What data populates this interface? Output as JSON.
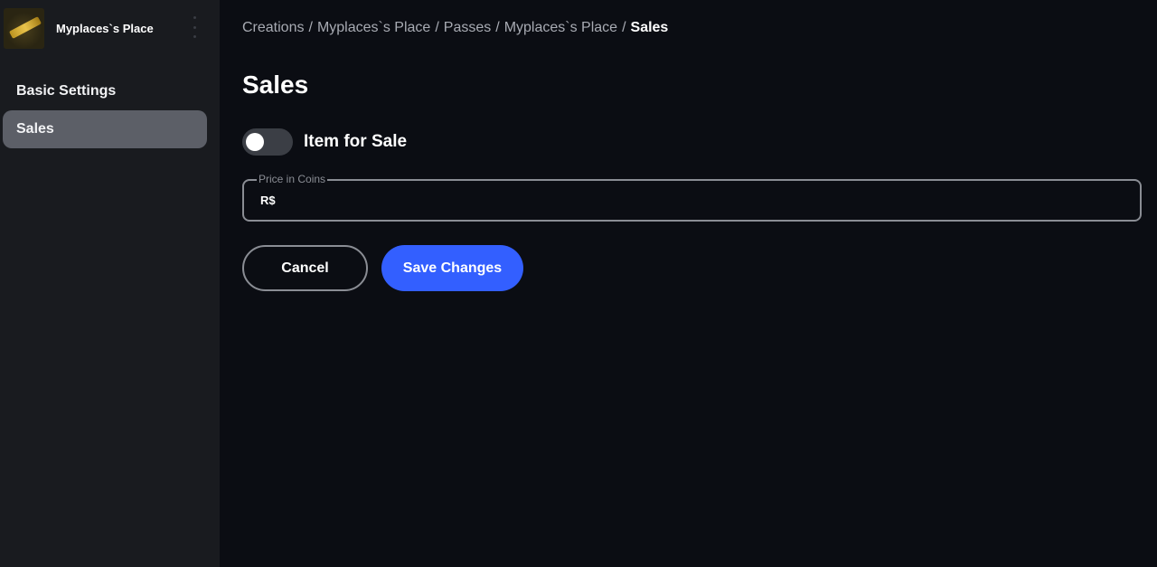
{
  "sidebar": {
    "place_name": "Myplaces`s Place",
    "items": [
      {
        "label": "Basic Settings",
        "active": false
      },
      {
        "label": "Sales",
        "active": true
      }
    ]
  },
  "breadcrumb": {
    "items": [
      "Creations",
      "Myplaces`s Place",
      "Passes",
      "Myplaces`s Place"
    ],
    "separator": "/",
    "current": "Sales"
  },
  "main": {
    "title": "Sales",
    "toggle": {
      "label": "Item for Sale",
      "on": false
    },
    "price_field": {
      "legend": "Price in Coins",
      "prefix": "R$",
      "value": ""
    },
    "buttons": {
      "cancel": "Cancel",
      "save": "Save Changes"
    }
  },
  "colors": {
    "background": "#0b0d13",
    "sidebar": "#191b1f",
    "active_nav": "#5c5f67",
    "primary": "#335fff",
    "border": "#8a8d94"
  },
  "icons": {
    "thumbnail": "place-thumbnail-gold-bar",
    "menu": "vertical-more-icon"
  }
}
